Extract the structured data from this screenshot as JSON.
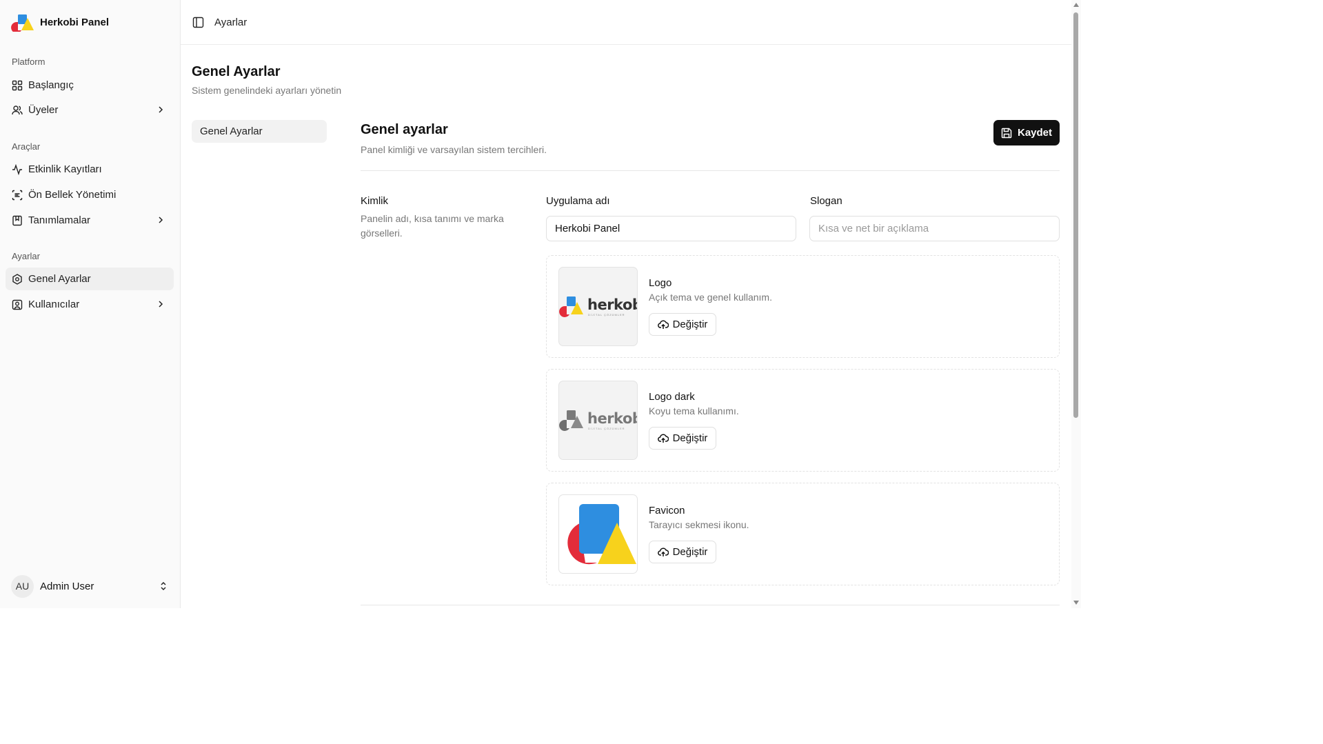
{
  "app": {
    "name": "Herkobi Panel"
  },
  "sidebar": {
    "groups": [
      {
        "label": "Platform",
        "items": [
          {
            "label": "Başlangıç",
            "icon": "grid-icon"
          },
          {
            "label": "Üyeler",
            "icon": "users-icon",
            "has_children": true
          }
        ]
      },
      {
        "label": "Araçlar",
        "items": [
          {
            "label": "Etkinlik Kayıtları",
            "icon": "activity-icon"
          },
          {
            "label": "Ön Bellek Yönetimi",
            "icon": "cache-icon"
          },
          {
            "label": "Tanımlamalar",
            "icon": "bookmark-icon",
            "has_children": true
          }
        ]
      },
      {
        "label": "Ayarlar",
        "items": [
          {
            "label": "Genel Ayarlar",
            "icon": "settings-icon",
            "active": true
          },
          {
            "label": "Kullanıcılar",
            "icon": "user-square-icon",
            "has_children": true
          }
        ]
      }
    ],
    "user": {
      "initials": "AU",
      "name": "Admin User"
    }
  },
  "topbar": {
    "breadcrumb": "Ayarlar"
  },
  "page": {
    "title": "Genel Ayarlar",
    "subtitle": "Sistem genelindeki ayarları yönetin",
    "subnav": [
      {
        "label": "Genel Ayarlar",
        "active": true
      }
    ]
  },
  "section": {
    "title": "Genel ayarlar",
    "subtitle": "Panel kimliği ve varsayılan sistem tercihleri.",
    "save_label": "Kaydet",
    "identity": {
      "title": "Kimlik",
      "description": "Panelin adı, kısa tanımı ve marka görselleri."
    },
    "fields": {
      "app_name": {
        "label": "Uygulama adı",
        "value": "Herkobi Panel"
      },
      "slogan": {
        "label": "Slogan",
        "value": "",
        "placeholder": "Kısa ve net bir açıklama"
      }
    },
    "images": [
      {
        "title": "Logo",
        "description": "Açık tema ve genel kullanım.",
        "button": "Değiştir",
        "wordmark": "herkobi",
        "tagline": "DİJİTAL ÇÖZÜMLER"
      },
      {
        "title": "Logo dark",
        "description": "Koyu tema kullanımı.",
        "button": "Değiştir",
        "wordmark": "herkobi",
        "tagline": "DİJİTAL ÇÖZÜMLER"
      },
      {
        "title": "Favicon",
        "description": "Tarayıcı sekmesi ikonu.",
        "button": "Değiştir"
      }
    ]
  },
  "colors": {
    "brand_blue": "#2e8ee0",
    "brand_red": "#e32c3a",
    "brand_yellow": "#f7d21c",
    "primary_button": "#111111"
  }
}
